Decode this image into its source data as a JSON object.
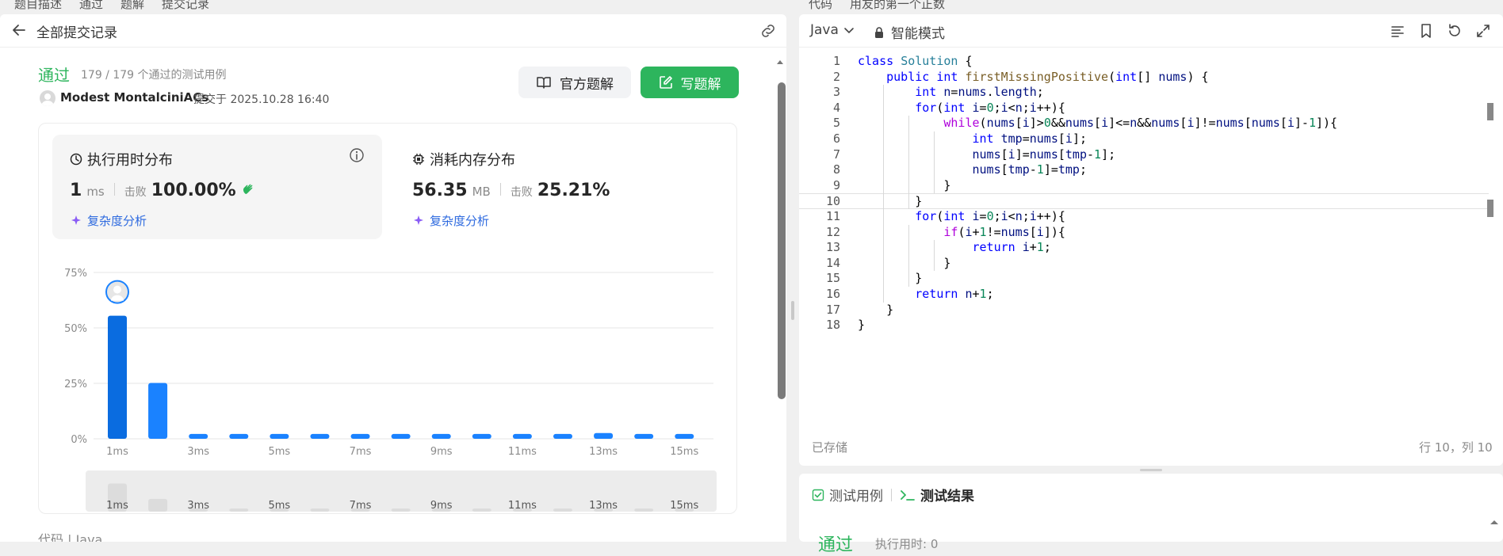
{
  "top_tabs": {
    "left": [
      "题目描述",
      "通过",
      "题解",
      "提交记录"
    ],
    "right": [
      "代码",
      "用友的第一个正数"
    ]
  },
  "header": {
    "back_title": "全部提交记录"
  },
  "submission": {
    "status": "通过",
    "testcases": "179 / 179 个通过的测试用例",
    "username": "Modest MontalciniACs",
    "submitted_at": "提交于 2025.10.28 16:40"
  },
  "buttons": {
    "official": "官方题解",
    "write": "写题解"
  },
  "runtime": {
    "title": "执行用时分布",
    "value": "1",
    "unit": "ms",
    "beat_label": "击败",
    "beat": "100.00%",
    "complexity": "复杂度分析"
  },
  "memory": {
    "title": "消耗内存分布",
    "value": "56.35",
    "unit": "MB",
    "beat_label": "击败",
    "beat": "25.21%",
    "complexity": "复杂度分析"
  },
  "chart_data": {
    "type": "bar",
    "categories": [
      "1ms",
      "2ms",
      "3ms",
      "4ms",
      "5ms",
      "6ms",
      "7ms",
      "8ms",
      "9ms",
      "10ms",
      "11ms",
      "12ms",
      "13ms",
      "14ms",
      "15ms"
    ],
    "tick_labels": [
      "1ms",
      "3ms",
      "5ms",
      "7ms",
      "9ms",
      "11ms",
      "13ms",
      "15ms"
    ],
    "values": [
      55.5,
      25.2,
      2.2,
      2.2,
      2.2,
      2.2,
      2.2,
      2.2,
      2.2,
      2.2,
      2.2,
      2.2,
      2.6,
      2.2,
      2.2
    ],
    "y_ticks": [
      "0%",
      "25%",
      "50%",
      "75%"
    ],
    "ylim": [
      0,
      75
    ],
    "highlight_index": 0,
    "grid": true,
    "colors": {
      "bar": "#1a82ff",
      "bar_highlight": "#0a6ce0",
      "grid": "#e6e6e6"
    }
  },
  "code_label": "代码 | Java",
  "editor": {
    "language": "Java",
    "mode": "智能模式",
    "saved": "已存储",
    "cursor": "行 10，列 10",
    "lines": [
      "class Solution {",
      "    public int firstMissingPositive(int[] nums) {",
      "        int n=nums.length;",
      "        for(int i=0;i<n;i++){",
      "            while(nums[i]>0&&nums[i]<=n&&nums[i]!=nums[nums[i]-1]){",
      "                int tmp=nums[i];",
      "                nums[i]=nums[tmp-1];",
      "                nums[tmp-1]=tmp;",
      "            }",
      "        }",
      "        for(int i=0;i<n;i++){",
      "            if(i+1!=nums[i]){",
      "                return i+1;",
      "            }",
      "        }",
      "        return n+1;",
      "    }",
      "}"
    ]
  },
  "test_panel": {
    "tab_case": "测试用例",
    "tab_result": "测试结果",
    "status": "通过",
    "time": "执行用时: 0"
  },
  "colors": {
    "accent_green": "#2db55d",
    "link_blue": "#2f6bdf"
  }
}
